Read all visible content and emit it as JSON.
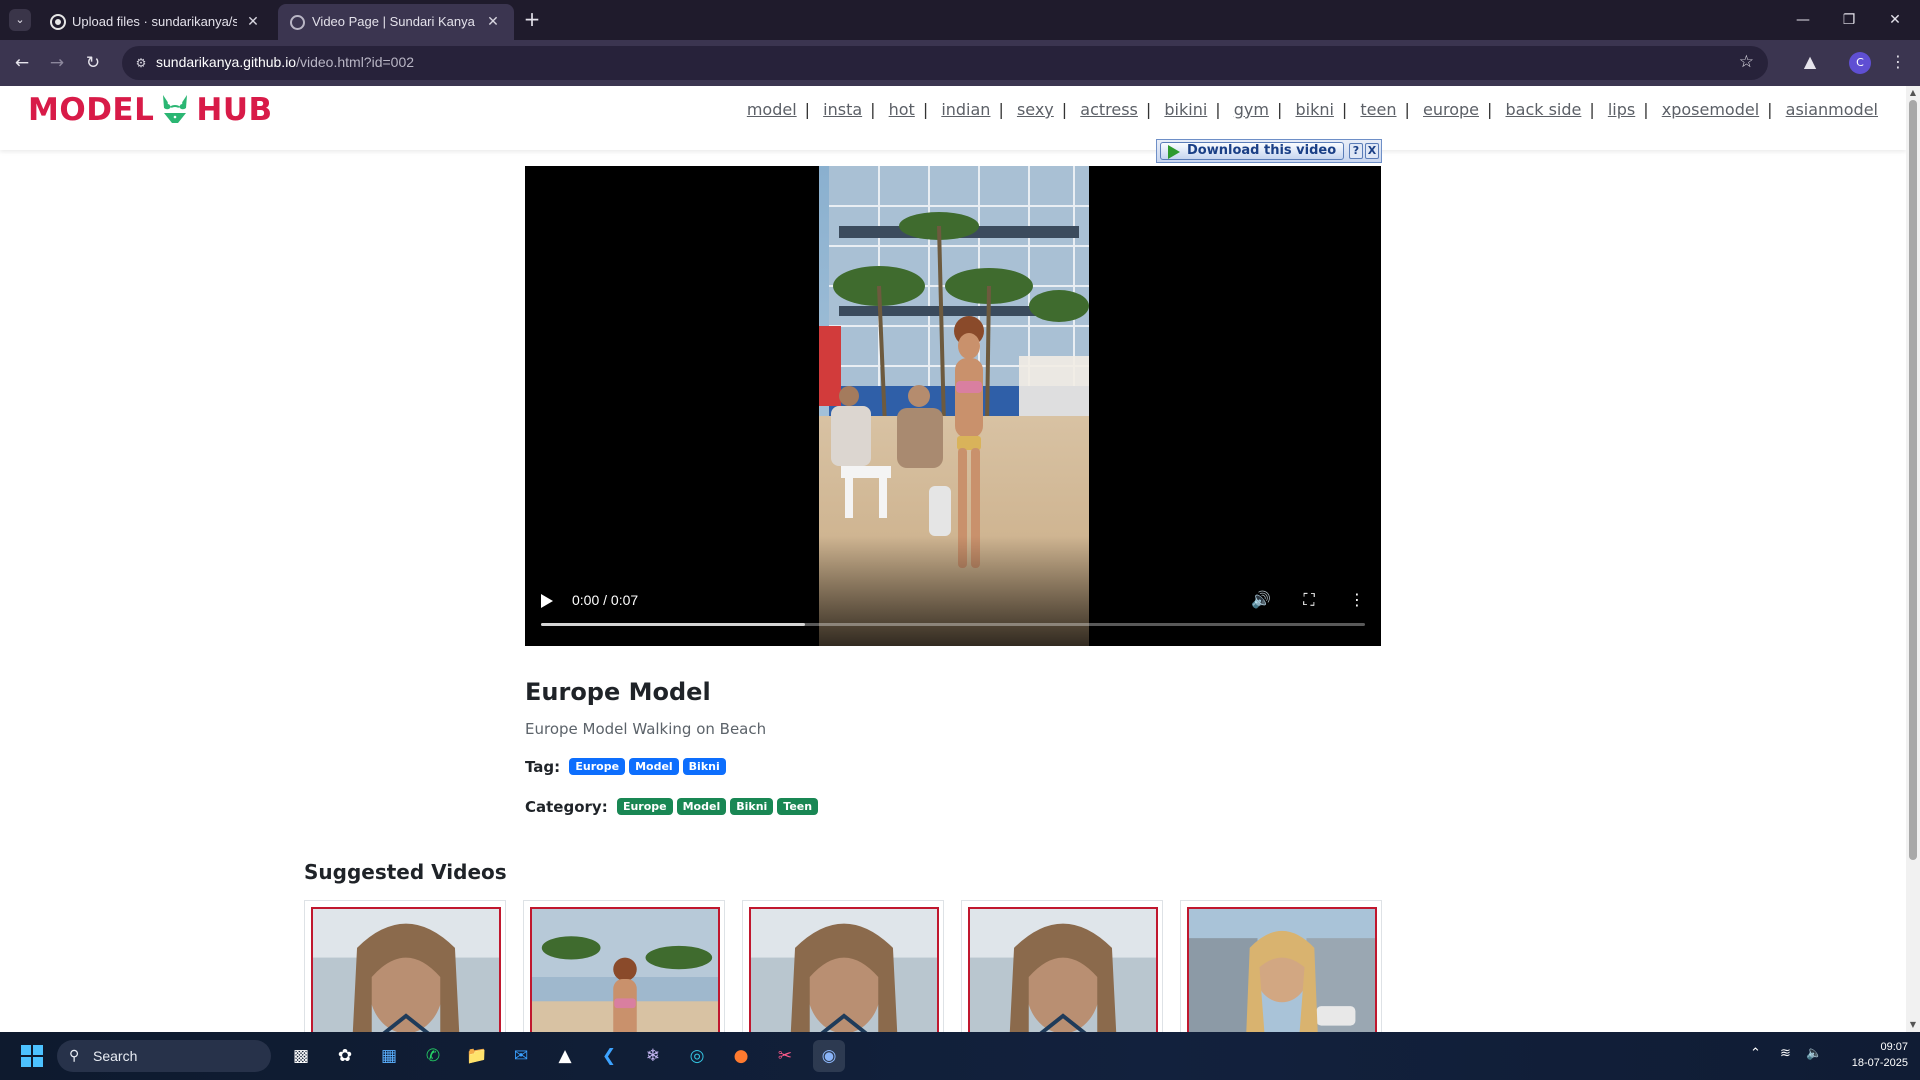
{
  "browser": {
    "tabs": [
      {
        "title": "Upload files · sundarikanya/sun",
        "active": false,
        "favicon": "github-icon"
      },
      {
        "title": "Video Page | Sundari Kanya",
        "active": true,
        "favicon": "globe-icon"
      }
    ],
    "url_host": "sundarikanya.github.io",
    "url_path": "/video.html?id=002",
    "profile_initial": "C"
  },
  "site": {
    "logo_left": "MODEL",
    "logo_right": "HUB",
    "nav": [
      "model",
      "insta",
      "hot",
      "indian",
      "sexy",
      "actress",
      "bikini",
      "gym",
      "bikni",
      "teen",
      "europe",
      "back side",
      "lips",
      "xposemodel",
      "asianmodel"
    ],
    "nav_separator": "|"
  },
  "download_bar": {
    "label": "Download this video",
    "help": "?",
    "close": "X"
  },
  "video": {
    "time": "0:00 / 0:07",
    "progress_buffered": 0.32,
    "title": "Europe Model",
    "description": "Europe Model Walking on Beach",
    "tag_label": "Tag:",
    "tags": [
      "Europe",
      "Model",
      "Bikni"
    ],
    "category_label": "Category:",
    "categories": [
      "Europe",
      "Model",
      "Bikni",
      "Teen"
    ]
  },
  "suggested": {
    "title": "Suggested Videos",
    "cards": [
      {
        "thumb": "girl-ocean"
      },
      {
        "thumb": "beach-palms"
      },
      {
        "thumb": "girl-ocean"
      },
      {
        "thumb": "girl-ocean"
      },
      {
        "thumb": "girl-building"
      }
    ]
  },
  "taskbar": {
    "search_label": "Search",
    "time": "09:07",
    "date": "18-07-2025"
  },
  "colors": {
    "brand": "#d81b48",
    "tag_badge": "#0d6efd",
    "category_badge": "#198754",
    "thumb_border": "#c0172e"
  }
}
